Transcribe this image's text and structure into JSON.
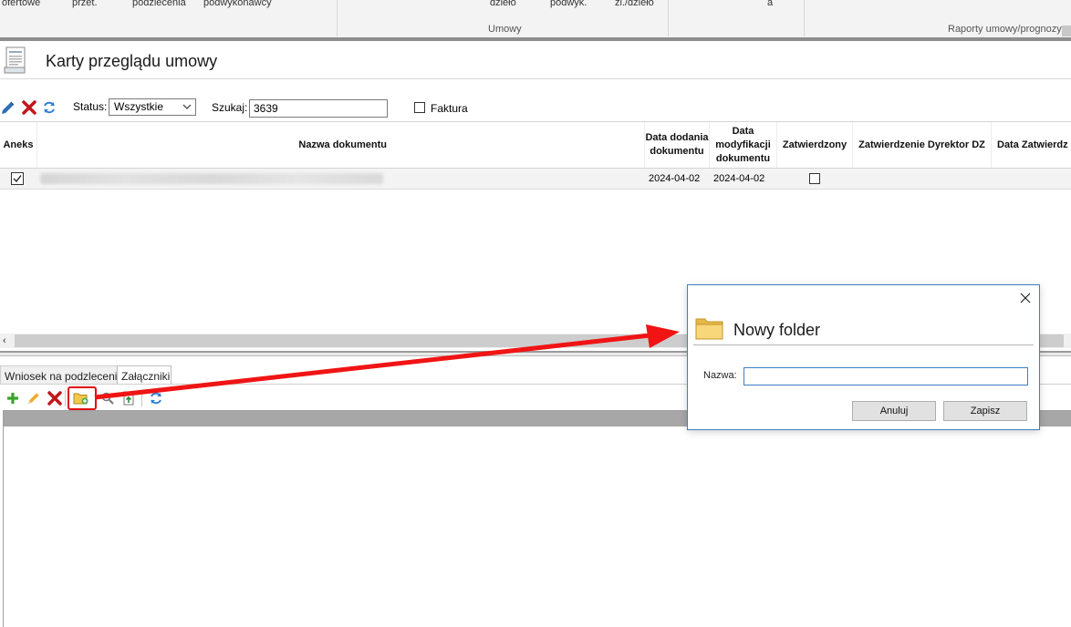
{
  "ribbon": {
    "items": [
      "ofertowe",
      "przet.",
      "podzlecenia",
      "podwykonawcy",
      "dzieło",
      "podwyk.",
      "zl./dzieło",
      "a"
    ],
    "groups": [
      "Umowy",
      "Raporty umowy/prognozy"
    ]
  },
  "page": {
    "title": "Karty przeglądu umowy"
  },
  "toolbar": {
    "status_label": "Status:",
    "status_value": "Wszystkie",
    "search_label": "Szukaj:",
    "search_value": "3639",
    "invoice_label": "Faktura"
  },
  "grid": {
    "columns": [
      "Aneks",
      "Nazwa dokumentu",
      "Data dodania dokumentu",
      "Data modyfikacji dokumentu",
      "Zatwierdzony",
      "Zatwierdzenie Dyrektor DZ",
      "Data Zatwierdz"
    ],
    "rows": [
      {
        "aneks_checked": true,
        "date_added": "2024-04-02",
        "date_modified": "2024-04-02",
        "approved": false
      }
    ]
  },
  "tabs": [
    "Wniosek na podzlecenie",
    "Załączniki"
  ],
  "dialog": {
    "title": "Nowy folder",
    "name_label": "Nazwa:",
    "name_value": "",
    "cancel_label": "Anuluj",
    "save_label": "Zapisz"
  },
  "colors": {
    "accent": "#3c7fc4",
    "highlight": "#e01010",
    "delete": "#c0171b",
    "add": "#3aa32a"
  }
}
